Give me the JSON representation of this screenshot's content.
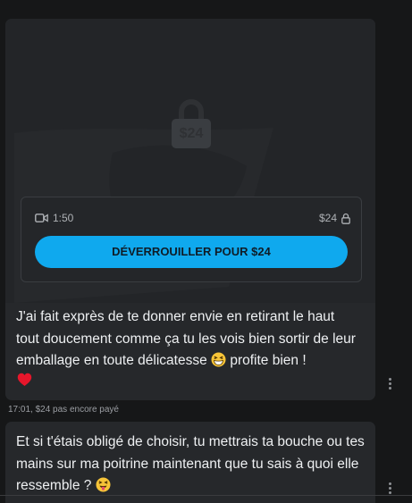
{
  "locked_post": {
    "lock_price": "$24",
    "duration": "1:50",
    "price": "$24",
    "unlock_button": "DÉVERROUILLER POUR $24",
    "message": "J'ai fait exprès de te donner envie en retirant le haut tout doucement comme ça tu les vois bien sortir de leur emballage en toute délicatesse",
    "message_tail": "profite bien !",
    "status": "17:01,  $24 pas encore payé"
  },
  "second_message": {
    "text": "Et si t'étais obligé de choisir, tu mettrais ta bouche ou tes mains sur ma poitrine maintenant que tu sais à quoi elle ressemble ?"
  },
  "icons": {
    "lock": "lock-icon",
    "video": "video-camera-icon",
    "small_lock": "small-lock-icon",
    "grin": "grinning-squinting-face-emoji",
    "heart": "red-heart-emoji",
    "tongue": "squinting-face-with-tongue-emoji",
    "menu": "more-vertical-icon"
  },
  "colors": {
    "accent": "#0fa9ee",
    "card": "#26282b",
    "background": "#161718"
  }
}
